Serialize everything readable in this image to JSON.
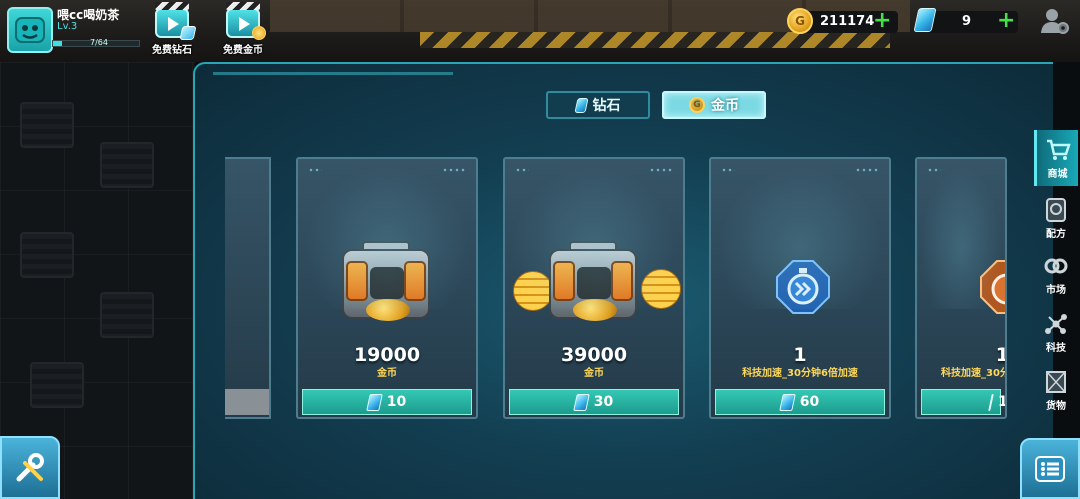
{
  "player": {
    "name": "喂cc喝奶茶",
    "level": "Lv.3",
    "xp_text": "7/64",
    "xp_fraction": 0.11
  },
  "video_buttons": [
    {
      "label": "免费钻石",
      "icon": "video-gem-icon"
    },
    {
      "label": "免费金币",
      "icon": "video-coin-icon"
    }
  ],
  "resources": {
    "gold": {
      "icon": "coin-icon",
      "value": "211174",
      "coin_letter": "G"
    },
    "gems": {
      "icon": "gem-icon",
      "value": "9"
    }
  },
  "tabs": [
    {
      "label": "钻石",
      "active": false,
      "icon": "gem-icon"
    },
    {
      "label": "金币",
      "active": true,
      "icon": "coin-icon"
    }
  ],
  "cards": [
    {
      "art": "gold-chest",
      "amount": "19000",
      "sub": "金币",
      "price": "10"
    },
    {
      "art": "gold-chest-large",
      "amount": "39000",
      "sub": "金币",
      "price": "30"
    },
    {
      "art": "speed-up-icon",
      "amount": "1",
      "sub": "科技加速_30分钟6倍加速",
      "price": "60"
    },
    {
      "art": "speed-up-icon-bronze",
      "amount": "1",
      "sub": "科技加速_30分",
      "price": "1"
    }
  ],
  "nav": [
    {
      "label": "商城",
      "icon": "cart-icon",
      "active": true
    },
    {
      "label": "配方",
      "icon": "recipe-icon",
      "active": false
    },
    {
      "label": "市场",
      "icon": "market-icon",
      "active": false
    },
    {
      "label": "科技",
      "icon": "tech-icon",
      "active": false
    },
    {
      "label": "货物",
      "icon": "cargo-icon",
      "active": false
    }
  ],
  "colors": {
    "accent": "#3fe0e0",
    "price_button": "#2bb5a3",
    "gold_text": "#ffd85a",
    "plus": "#44e04a"
  }
}
